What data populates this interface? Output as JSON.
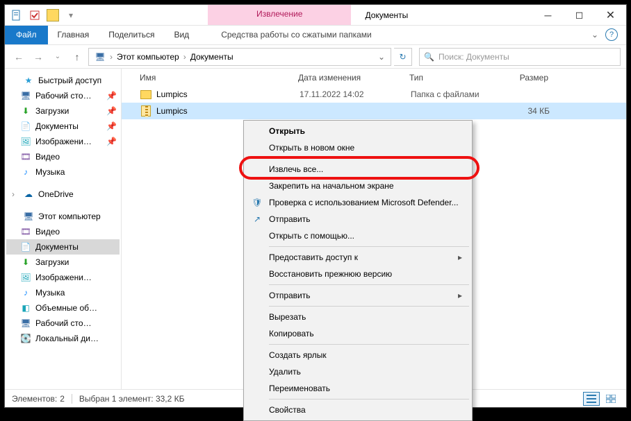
{
  "title": {
    "context_tab": "Извлечение",
    "window_title": "Документы"
  },
  "ribbon": {
    "file": "Файл",
    "home": "Главная",
    "share": "Поделиться",
    "view": "Вид",
    "context": "Средства работы со сжатыми папками"
  },
  "breadcrumb": {
    "root": "Этот компьютер",
    "folder": "Документы"
  },
  "search_placeholder": "Поиск: Документы",
  "columns": {
    "name": "Имя",
    "date": "Дата изменения",
    "type": "Тип",
    "size": "Размер"
  },
  "rows": [
    {
      "name": "Lumpics",
      "date": "17.11.2022 14:02",
      "type": "Папка с файлами",
      "size": ""
    },
    {
      "name": "Lumpics",
      "date": "",
      "type": "",
      "size": "34 КБ"
    }
  ],
  "sidebar": {
    "quick": "Быстрый доступ",
    "desk": "Рабочий сто…",
    "downloads": "Загрузки",
    "docs": "Документы",
    "images": "Изображени…",
    "video": "Видео",
    "music": "Музыка",
    "onedrive": "OneDrive",
    "pc": "Этот компьютер",
    "pc_video": "Видео",
    "pc_docs": "Документы",
    "pc_dl": "Загрузки",
    "pc_img": "Изображени…",
    "pc_mus": "Музыка",
    "pc_3d": "Объемные об…",
    "pc_desk": "Рабочий сто…",
    "pc_disk": "Локальный ди…"
  },
  "ctx": {
    "open": "Открыть",
    "open_new": "Открыть в новом окне",
    "extract_all": "Извлечь все...",
    "pin_start": "Закрепить на начальном экране",
    "defender": "Проверка с использованием Microsoft Defender...",
    "send": "Отправить",
    "open_with": "Открыть с помощью...",
    "give_access": "Предоставить доступ к",
    "restore": "Восстановить прежнюю версию",
    "send_to": "Отправить",
    "cut": "Вырезать",
    "copy": "Копировать",
    "shortcut": "Создать ярлык",
    "delete": "Удалить",
    "rename": "Переименовать",
    "properties": "Свойства"
  },
  "status": {
    "items_label": "Элементов:",
    "items_count": "2",
    "selected": "Выбран 1 элемент: 33,2 КБ"
  }
}
